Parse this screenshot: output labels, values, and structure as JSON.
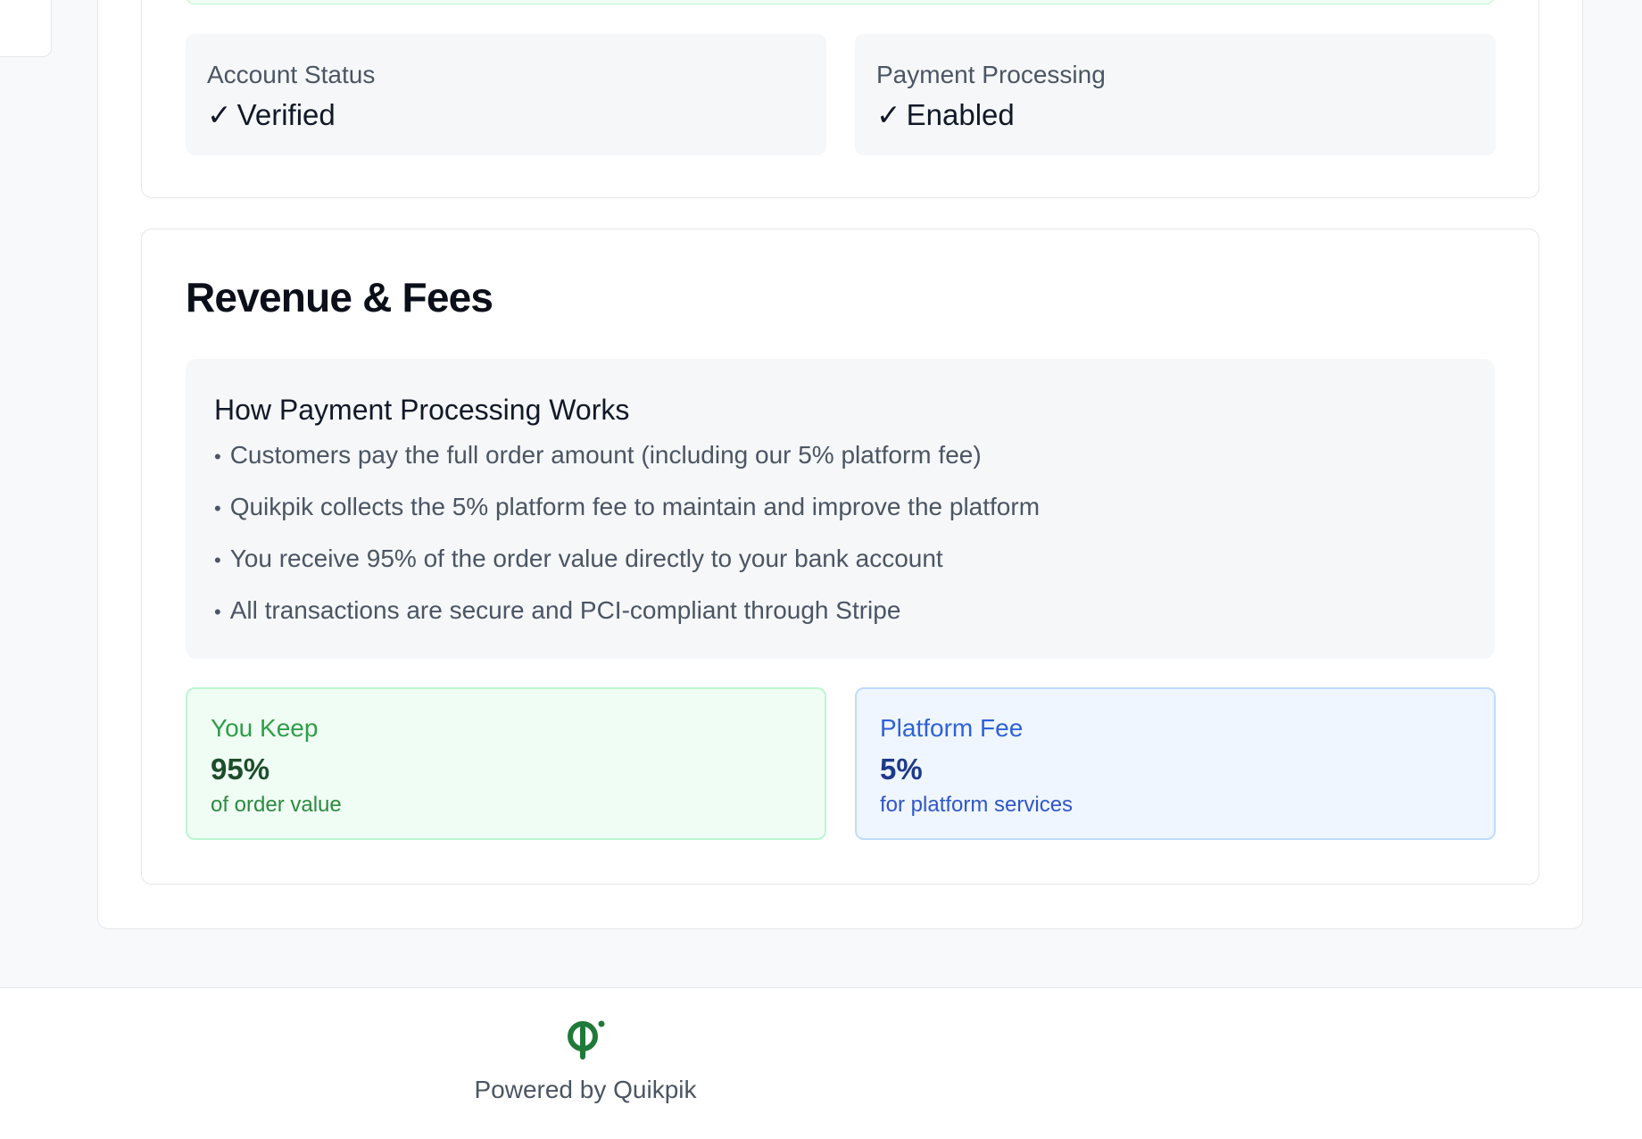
{
  "account_status": {
    "label": "Account Status",
    "check": "✓",
    "value": "Verified"
  },
  "payment_processing": {
    "label": "Payment Processing",
    "check": "✓",
    "value": "Enabled"
  },
  "revenue": {
    "title": "Revenue & Fees",
    "how_it_works": {
      "title": "How Payment Processing Works",
      "bullet": "•",
      "items": [
        "Customers pay the full order amount (including our 5% platform fee)",
        "Quikpik collects the 5% platform fee to maintain and improve the platform",
        "You receive 95% of the order value directly to your bank account",
        "All transactions are secure and PCI-compliant through Stripe"
      ]
    },
    "you_keep": {
      "label": "You Keep",
      "value": "95%",
      "sub": "of order value"
    },
    "platform_fee": {
      "label": "Platform Fee",
      "value": "5%",
      "sub": "for platform services"
    }
  },
  "footer": {
    "logo_icon": "quikpik-logo-icon",
    "text": "Powered by Quikpik"
  },
  "colors": {
    "brand_green": "#1f7a3a",
    "keep_green": "#2f9e48",
    "fee_blue": "#2f62d6"
  }
}
